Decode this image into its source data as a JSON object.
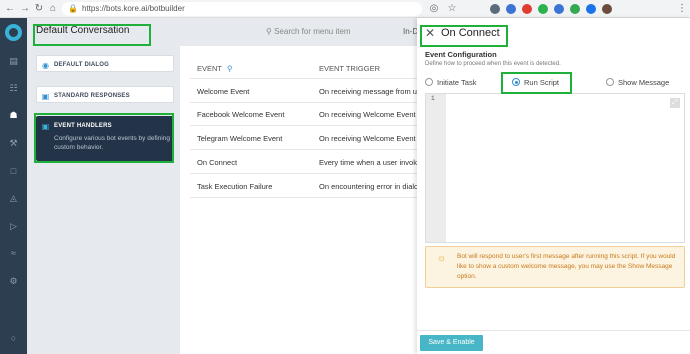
{
  "browser": {
    "url": "https://bots.kore.ai/botbuilder",
    "extensions": [
      {
        "name": "extension-icon-1",
        "color": "#5a6b7c"
      },
      {
        "name": "extension-icon-2",
        "color": "#3b73d6"
      },
      {
        "name": "extension-icon-3",
        "color": "#e03c31"
      },
      {
        "name": "extension-icon-4",
        "color": "#2bb24c"
      },
      {
        "name": "extension-icon-5",
        "color": "#3b73d6"
      },
      {
        "name": "extension-icon-6",
        "color": "#34a853"
      },
      {
        "name": "extension-icon-7",
        "color": "#1a73e8"
      },
      {
        "name": "extension-icon-8",
        "color": "#6b4c3b"
      }
    ]
  },
  "header": {
    "title": "Default Conversation",
    "search_placeholder": "Search for menu item",
    "indicator": "In-D"
  },
  "menu": {
    "default_dialog": "DEFAULT DIALOG",
    "standard_responses": "STANDARD RESPONSES",
    "event_handlers": "EVENT HANDLERS",
    "event_handlers_desc": "Configure various bot events by defining custom behavior."
  },
  "events": {
    "col_event": "EVENT",
    "col_trigger": "EVENT TRIGGER",
    "rows": [
      {
        "event": "Welcome Event",
        "trigger": "On receiving message from use"
      },
      {
        "event": "Facebook Welcome Event",
        "trigger": "On receiving Welcome Event f"
      },
      {
        "event": "Telegram Welcome Event",
        "trigger": "On receiving Welcome Event f"
      },
      {
        "event": "On Connect",
        "trigger": "Every time when a user invoke"
      },
      {
        "event": "Task Execution Failure",
        "trigger": "On encountering error in dialo"
      }
    ]
  },
  "panel": {
    "title": "On Connect",
    "section_title": "Event Configuration",
    "section_sub": "Define how to proceed when this event is detected.",
    "options": [
      "Initiate Task",
      "Run Script",
      "Show Message"
    ],
    "selected_option": "Run Script",
    "line_number": "1",
    "info": "Bot will respond to user's first message after running this script. If you would like to show a custom welcome message, you may use the Show Message option.",
    "save_button": "Save & Enable"
  },
  "colors": {
    "accent": "#47b6c6",
    "sidebar": "#2c3e50",
    "highlight": "#1fb03a",
    "warning_bg": "#fdf3e1",
    "warning_text": "#c77a1a"
  }
}
